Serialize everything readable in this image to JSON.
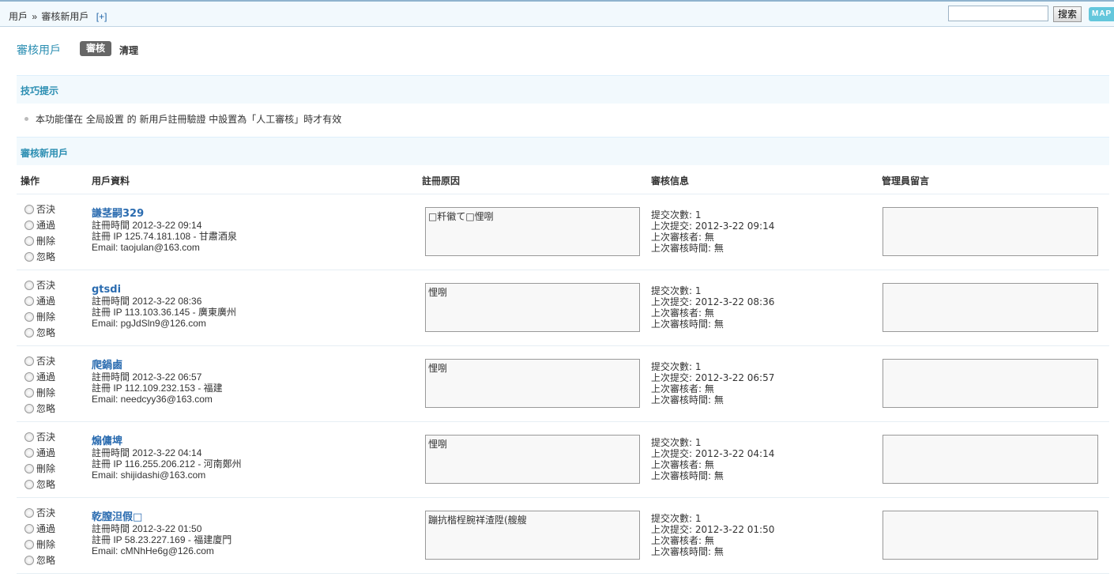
{
  "breadcrumb": {
    "root": "用戶",
    "separator": "»",
    "current": "審核新用戶",
    "add": "[+]"
  },
  "search": {
    "placeholder": "",
    "button": "搜索",
    "map": "MAP"
  },
  "header": {
    "title": "審核用戶",
    "tabs": [
      {
        "label": "審核",
        "active": true
      },
      {
        "label": "清理",
        "active": false
      }
    ]
  },
  "tips": {
    "title": "技巧提示",
    "text": "本功能僅在 全局設置 的 新用戶註冊驗證 中設置為「人工審核」時才有效"
  },
  "review": {
    "title": "審核新用戶",
    "columns": {
      "op": "操作",
      "user": "用戶資料",
      "reason": "註冊原因",
      "info": "審核信息",
      "remark": "管理員留言"
    },
    "options": [
      "否決",
      "通過",
      "刪除",
      "忽略"
    ],
    "rows": [
      {
        "name": "謙茎嗣329",
        "reg_time": "註冊時間 2012-3-22 09:14",
        "reg_ip": "註冊 IP 125.74.181.108 - 甘肅酒泉",
        "email": "Email: taojulan@163.com",
        "reason": "□粁徽て□悝哵",
        "submits": "提交次數: 1",
        "last_submit": "上次提交: 2012-3-22 09:14",
        "last_reviewer": "上次審核者: 無",
        "last_review_time": "上次審核時間: 無"
      },
      {
        "name": "gtsdi",
        "reg_time": "註冊時間 2012-3-22 08:36",
        "reg_ip": "註冊 IP 113.103.36.145 - 廣東廣州",
        "email": "Email: pgJdSln9@126.com",
        "reason": "悝哵",
        "submits": "提交次數: 1",
        "last_submit": "上次提交: 2012-3-22 08:36",
        "last_reviewer": "上次審核者: 無",
        "last_review_time": "上次審核時間: 無"
      },
      {
        "name": "爬鍋鹵",
        "reg_time": "註冊時間 2012-3-22 06:57",
        "reg_ip": "註冊 IP 112.109.232.153 - 福建",
        "email": "Email: needcyy36@163.com",
        "reason": "悝哵",
        "submits": "提交次數: 1",
        "last_submit": "上次提交: 2012-3-22 06:57",
        "last_reviewer": "上次審核者: 無",
        "last_review_time": "上次審核時間: 無"
      },
      {
        "name": "煽傭埤",
        "reg_time": "註冊時間 2012-3-22 04:14",
        "reg_ip": "註冊 IP 116.255.206.212 - 河南鄭州",
        "email": "Email: shijidashi@163.com",
        "reason": "悝哵",
        "submits": "提交次數: 1",
        "last_submit": "上次提交: 2012-3-22 04:14",
        "last_reviewer": "上次審核者: 無",
        "last_review_time": "上次審核時間: 無"
      },
      {
        "name": "乾膣泹假□",
        "reg_time": "註冊時間 2012-3-22 01:50",
        "reg_ip": "註冊 IP 58.23.227.169 - 福建廈門",
        "email": "Email: cMNhHe6g@126.com",
        "reason": "蹦抗楷桯腕祥渣陞(艘艘",
        "submits": "提交次數: 1",
        "last_submit": "上次提交: 2012-3-22 01:50",
        "last_reviewer": "上次審核者: 無",
        "last_review_time": "上次審核時間: 無"
      }
    ]
  }
}
